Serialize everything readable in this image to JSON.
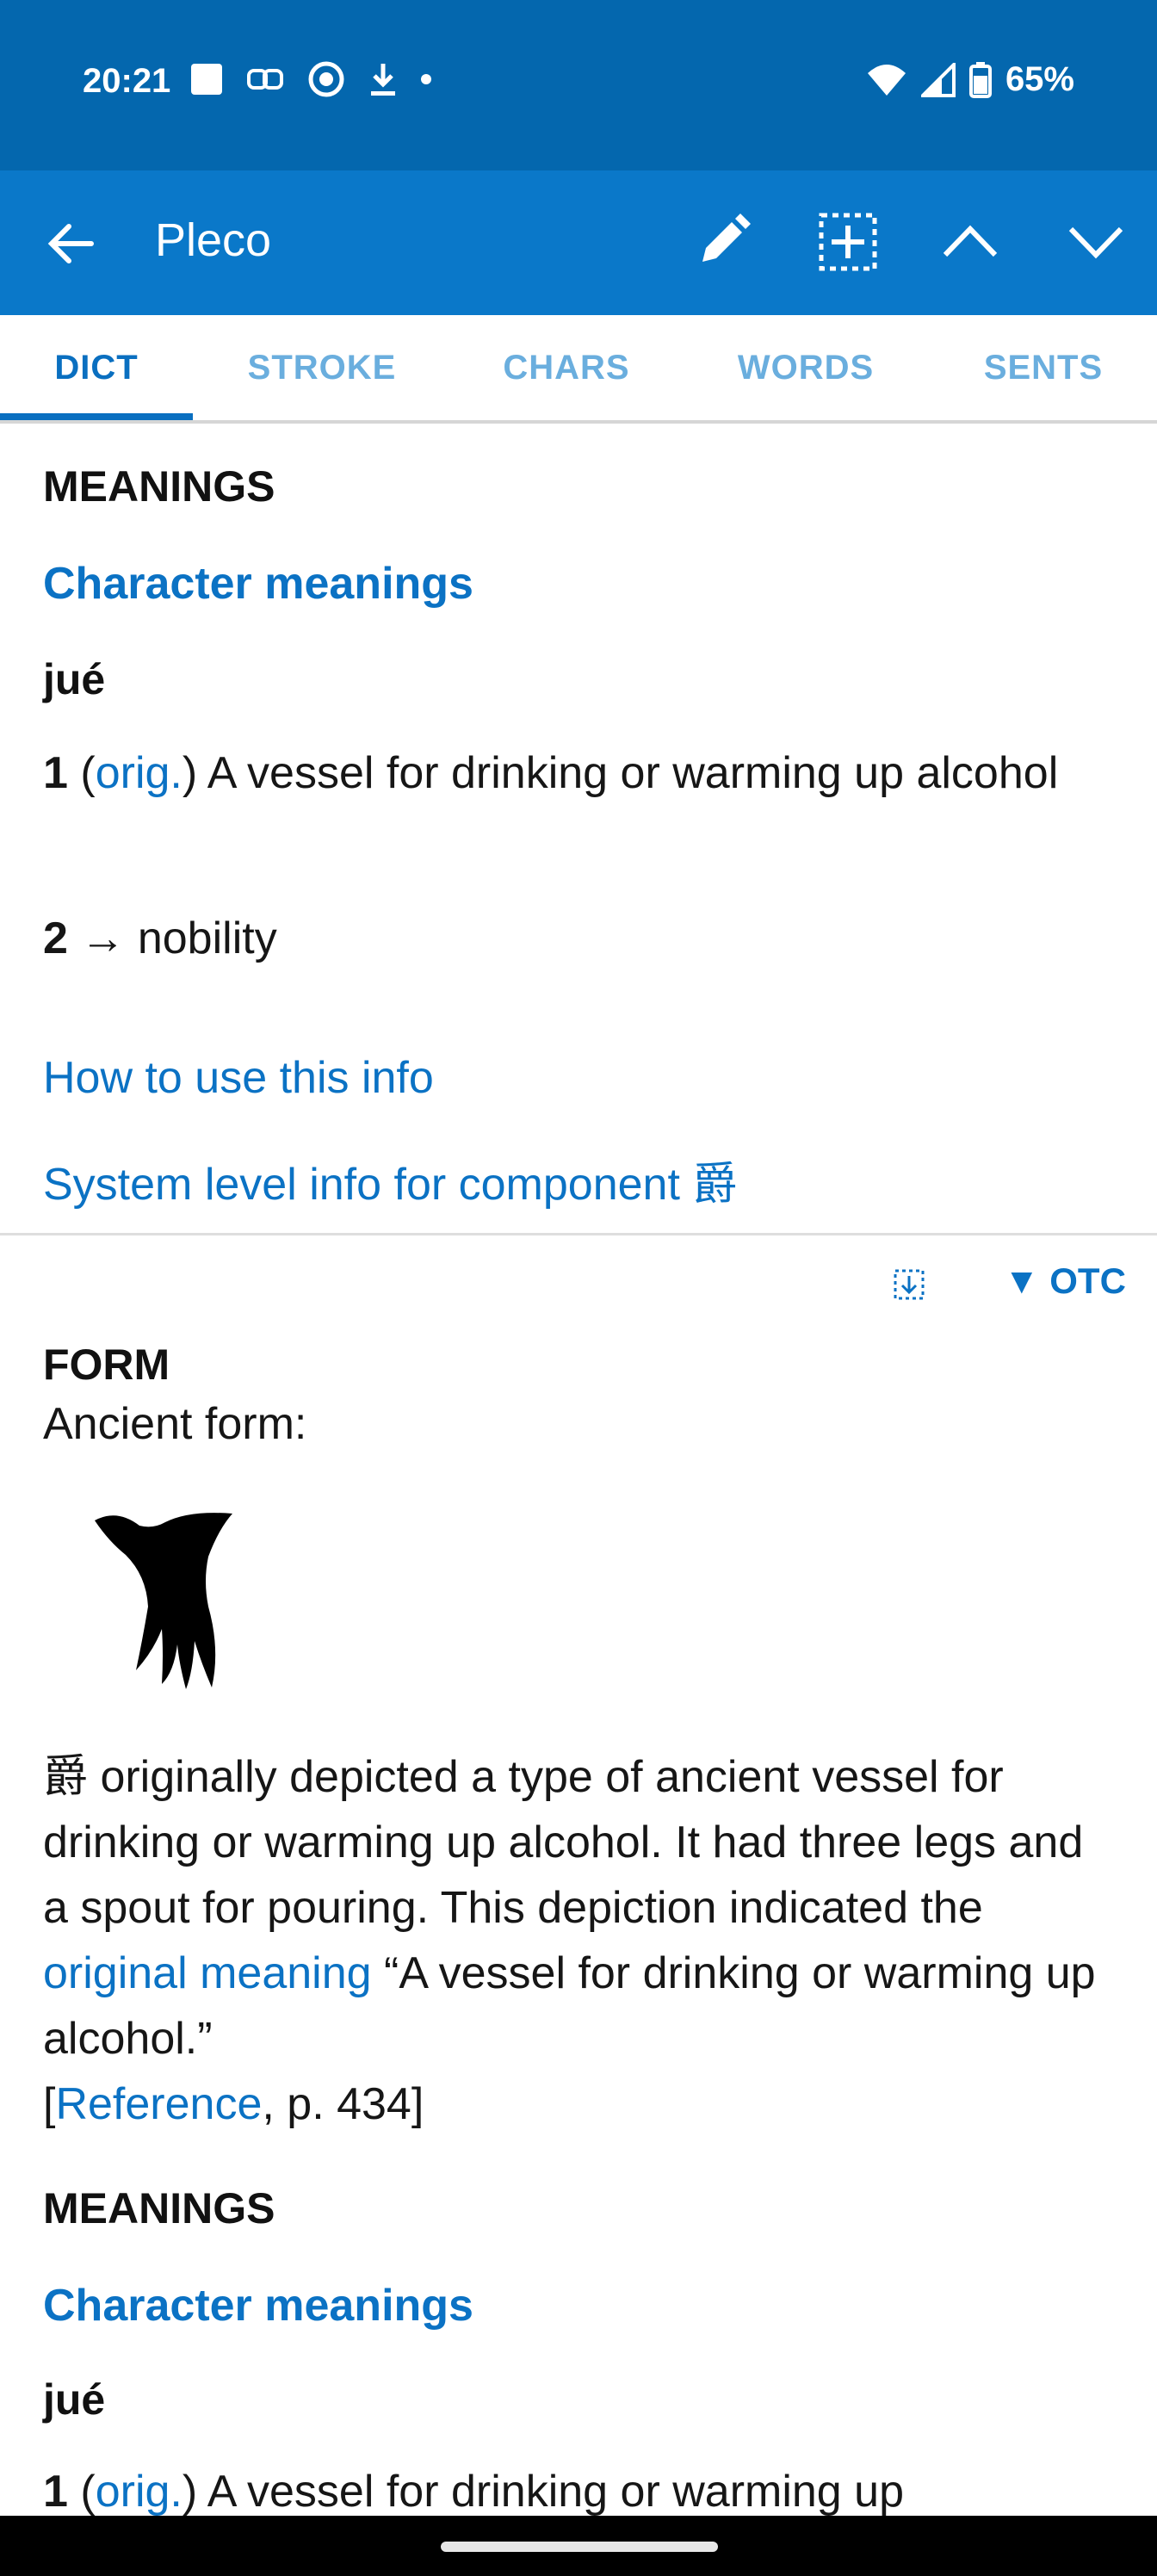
{
  "status_bar": {
    "time": "20:21",
    "battery": "65%",
    "icons": [
      "stop-square-icon",
      "link-icon",
      "cloud-sync-icon",
      "download-icon",
      "dot-icon",
      "wifi-icon",
      "signal-icon",
      "battery-icon"
    ]
  },
  "app_bar": {
    "title": "Pleco",
    "actions": [
      "back-arrow-icon",
      "pencil-icon",
      "add-box-icon",
      "chevron-up-icon",
      "chevron-down-icon"
    ]
  },
  "tabs": [
    {
      "label": "DICT",
      "active": true
    },
    {
      "label": "STROKE",
      "active": false
    },
    {
      "label": "CHARS",
      "active": false
    },
    {
      "label": "WORDS",
      "active": false
    },
    {
      "label": "SENTS",
      "active": false
    }
  ],
  "meanings_1": {
    "heading": "MEANINGS",
    "subheading": "Character meanings",
    "pinyin": "jué",
    "items": [
      {
        "num": "1",
        "open": "(",
        "tag": "orig.",
        "close": ")",
        "text": " A vessel for drinking or warming up alcohol"
      },
      {
        "num": "2",
        "arrow": "→",
        "text": " nobility"
      }
    ]
  },
  "links": {
    "how_to_use": "How to use this info",
    "system_level": "System level info for component 爵"
  },
  "otc_bar": {
    "label": "▼ OTC"
  },
  "form": {
    "heading": "FORM",
    "ancient_label": "Ancient form:",
    "para_1": "爵 originally depicted a type of ancient vessel for drinking or warming up alcohol. It had three legs and a spout for pouring. This depiction indicated the ",
    "para_link": "original meaning",
    "para_2": " “A vessel for drinking or warming up alcohol.”",
    "ref_open": "[",
    "ref_link": "Reference",
    "ref_close": ", p. 434]"
  },
  "meanings_2": {
    "heading": "MEANINGS",
    "subheading": "Character meanings",
    "pinyin": "jué",
    "item_num": "1",
    "item_open": "(",
    "item_tag": "orig.",
    "item_text": ") A vessel for drinking or warming up"
  },
  "colors": {
    "status_bar": "#0467ae",
    "app_bar": "#0a78c9",
    "accent": "#0b72c4",
    "tab_inactive": "#6aaede"
  }
}
